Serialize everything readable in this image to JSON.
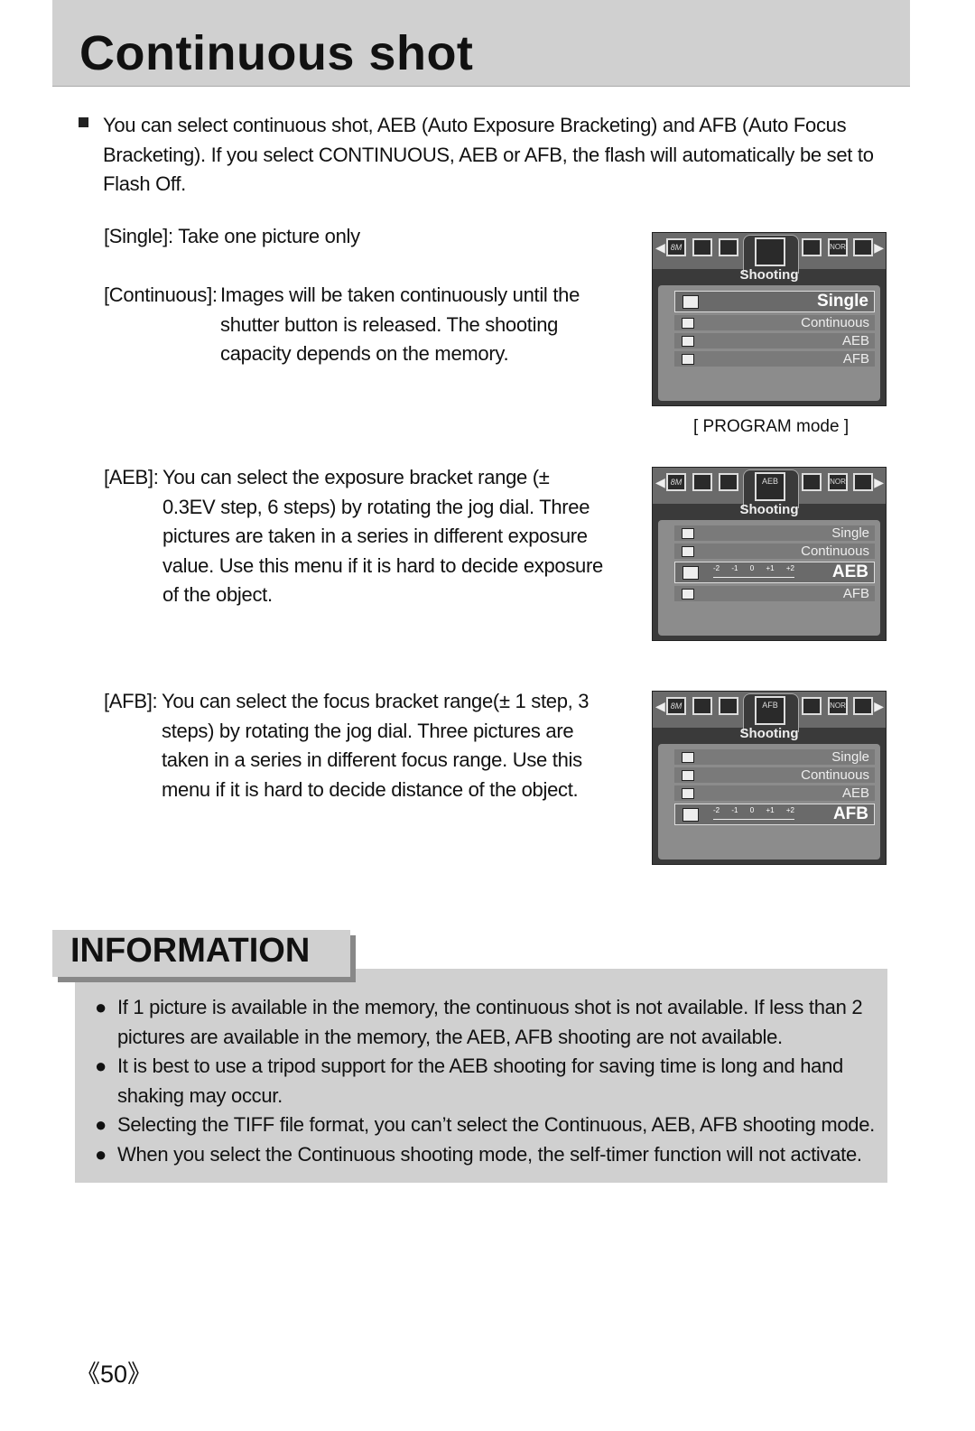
{
  "title": "Continuous shot",
  "intro": "You can select continuous shot, AEB (Auto Exposure Bracketing) and AFB (Auto Focus Bracketing). If you select CONTINUOUS, AEB or AFB, the flash will automatically be set to Flash Off.",
  "single_desc": "[Single]: Take one picture only",
  "continuous_label": "[Continuous]: ",
  "continuous_desc": "Images will be taken continuously until the shutter button is released. The shooting capacity depends on the memory.",
  "aeb_label": "[AEB]: ",
  "aeb_desc": "You can select the exposure bracket range (± 0.3EV step, 6 steps) by rotating the jog dial. Three pictures are taken in a series in different exposure value. Use this menu if it is hard to decide exposure of the object.",
  "afb_label": "[AFB]: ",
  "afb_desc": "You can select the focus bracket range(± 1 step, 3 steps) by rotating the jog dial. Three pictures are taken in a series in different focus range. Use this menu if it is hard to decide distance of the object.",
  "program_caption": "[ PROGRAM mode ]",
  "screens": [
    {
      "selected": "Single",
      "tab_icon": "",
      "menu_title": "Shooting",
      "items": [
        "Single",
        "Continuous",
        "AEB",
        "AFB"
      ]
    },
    {
      "selected": "AEB",
      "tab_icon": "AEB",
      "menu_title": "Shooting",
      "items": [
        "Single",
        "Continuous",
        "AEB",
        "AFB"
      ]
    },
    {
      "selected": "AFB",
      "tab_icon": "AFB",
      "menu_title": "Shooting",
      "items": [
        "Single",
        "Continuous",
        "AEB",
        "AFB"
      ]
    }
  ],
  "screen_icons": [
    "8M",
    "",
    "",
    "",
    "NOR",
    ""
  ],
  "scale_labels": [
    "-2",
    "-1",
    "0",
    "+1",
    "+2"
  ],
  "info_title": "INFORMATION",
  "info_bullets": [
    "If 1 picture is available in the memory, the continuous shot is not available. If less than 2 pictures are available in the memory, the AEB, AFB shooting are not available.",
    "It is best to use a tripod support for the AEB shooting for saving time is long and hand shaking may occur.",
    "Selecting the TIFF file format, you can’t select the Continuous, AEB, AFB shooting mode.",
    "When you select the Continuous shooting mode, the self-timer function will not activate."
  ],
  "bullet_glyph": "●",
  "page_number": "《50》"
}
